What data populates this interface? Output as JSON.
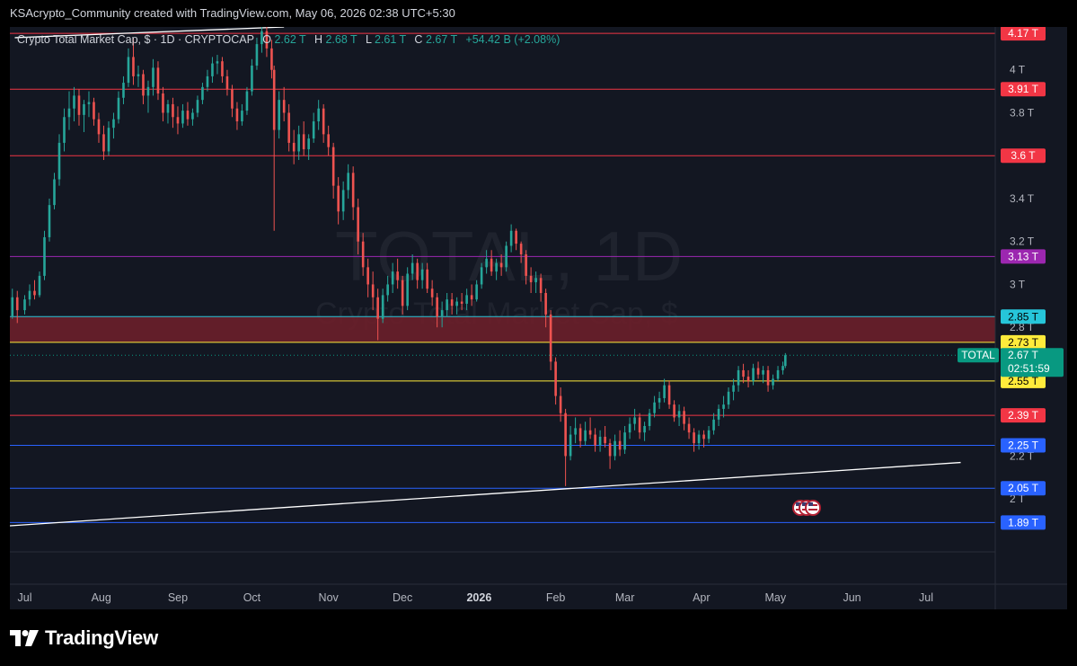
{
  "header": {
    "caption": "KSAcrypto_Community created with TradingView.com, May 06, 2026 02:38 UTC+5:30"
  },
  "legend": {
    "title": "Crypto Total Market Cap, $ · 1D · CRYPTOCAP",
    "o_label": "O",
    "o_value": "2.62 T",
    "h_label": "H",
    "h_value": "2.68 T",
    "l_label": "L",
    "l_value": "2.61 T",
    "c_label": "C",
    "c_value": "2.67 T",
    "change": "+54.42 B (+2.08%)"
  },
  "watermark": {
    "symbol": "TOTAL, 1D",
    "name": "Crypto Total Market Cap, $"
  },
  "footer": {
    "brand": "TradingView"
  },
  "colors": {
    "up": "#26a69a",
    "down": "#ef5350",
    "background": "#131722",
    "zone": "#6b1f2a"
  },
  "chart_data": {
    "type": "candlestick",
    "title": "Crypto Total Market Cap, $ · 1D · CRYPTOCAP",
    "price_unit": "T (trillion USD)",
    "x_range": [
      "2025-06-25",
      "2026-07-29"
    ],
    "y_range": [
      1.875,
      4.2
    ],
    "x_ticks": [
      {
        "label": "Jul",
        "date": "2025-07-01"
      },
      {
        "label": "Aug",
        "date": "2025-08-01"
      },
      {
        "label": "Sep",
        "date": "2025-09-01"
      },
      {
        "label": "Oct",
        "date": "2025-10-01"
      },
      {
        "label": "Nov",
        "date": "2025-11-01"
      },
      {
        "label": "Dec",
        "date": "2025-12-01"
      },
      {
        "label": "2026",
        "date": "2026-01-01",
        "bold": true
      },
      {
        "label": "Feb",
        "date": "2026-02-01"
      },
      {
        "label": "Mar",
        "date": "2026-03-01"
      },
      {
        "label": "Apr",
        "date": "2026-04-01"
      },
      {
        "label": "May",
        "date": "2026-05-01"
      },
      {
        "label": "Jun",
        "date": "2026-06-01"
      },
      {
        "label": "Jul",
        "date": "2026-07-01"
      }
    ],
    "y_ticks": [
      {
        "label": "4 T",
        "value": 4.0
      },
      {
        "label": "3.8 T",
        "value": 3.8
      },
      {
        "label": "3.4 T",
        "value": 3.4
      },
      {
        "label": "3.2 T",
        "value": 3.2
      },
      {
        "label": "3 T",
        "value": 3.0
      },
      {
        "label": "2.8 T",
        "value": 2.8
      },
      {
        "label": "2.2 T",
        "value": 2.2
      },
      {
        "label": "2 T",
        "value": 2.0
      }
    ],
    "horizontal_levels": [
      {
        "label": "4.17 T",
        "value": 4.17,
        "color": "#f23645",
        "text": "#ffffff"
      },
      {
        "label": "3.91 T",
        "value": 3.91,
        "color": "#f23645",
        "text": "#ffffff"
      },
      {
        "label": "3.6 T",
        "value": 3.6,
        "color": "#f23645",
        "text": "#ffffff"
      },
      {
        "label": "3.13 T",
        "value": 3.13,
        "color": "#9c27b0",
        "text": "#ffffff"
      },
      {
        "label": "2.85 T",
        "value": 2.85,
        "color": "#26c6da",
        "text": "#000000"
      },
      {
        "label": "2.73 T",
        "value": 2.73,
        "color": "#ffeb3b",
        "text": "#000000"
      },
      {
        "label": "2.55 T",
        "value": 2.55,
        "color": "#ffeb3b",
        "text": "#000000"
      },
      {
        "label": "2.39 T",
        "value": 2.39,
        "color": "#f23645",
        "text": "#ffffff"
      },
      {
        "label": "2.25 T",
        "value": 2.25,
        "color": "#2962ff",
        "text": "#ffffff"
      },
      {
        "label": "2.05 T",
        "value": 2.05,
        "color": "#2962ff",
        "text": "#ffffff"
      },
      {
        "label": "1.89 T",
        "value": 1.89,
        "color": "#2962ff",
        "text": "#ffffff"
      }
    ],
    "zone": {
      "from": 2.73,
      "to": 2.85
    },
    "last_price": {
      "name": "TOTAL",
      "value": 2.67,
      "label": "2.67 T",
      "countdown": "02:51:59",
      "color": "#089981"
    },
    "trendlines": [
      {
        "from": [
          "2025-06-25",
          1.875
        ],
        "to": [
          "2026-07-15",
          2.17
        ]
      },
      {
        "from": [
          "2025-06-27",
          4.15
        ],
        "to": [
          "2025-10-14",
          4.2
        ]
      }
    ],
    "candles": [
      [
        "2025-06-26",
        2.85,
        2.98,
        2.84,
        2.94
      ],
      [
        "2025-06-28",
        2.94,
        2.97,
        2.82,
        2.88
      ],
      [
        "2025-07-01",
        2.88,
        2.95,
        2.86,
        2.93
      ],
      [
        "2025-07-03",
        2.93,
        3.0,
        2.9,
        2.97
      ],
      [
        "2025-07-05",
        2.97,
        3.02,
        2.93,
        2.95
      ],
      [
        "2025-07-07",
        2.95,
        3.06,
        2.94,
        3.04
      ],
      [
        "2025-07-09",
        3.04,
        3.25,
        3.02,
        3.22
      ],
      [
        "2025-07-11",
        3.22,
        3.4,
        3.2,
        3.37
      ],
      [
        "2025-07-13",
        3.37,
        3.52,
        3.35,
        3.49
      ],
      [
        "2025-07-15",
        3.49,
        3.7,
        3.46,
        3.66
      ],
      [
        "2025-07-17",
        3.66,
        3.82,
        3.62,
        3.78
      ],
      [
        "2025-07-19",
        3.78,
        3.9,
        3.72,
        3.82
      ],
      [
        "2025-07-21",
        3.82,
        3.92,
        3.76,
        3.88
      ],
      [
        "2025-07-23",
        3.88,
        3.91,
        3.74,
        3.79
      ],
      [
        "2025-07-25",
        3.79,
        3.86,
        3.71,
        3.84
      ],
      [
        "2025-07-27",
        3.84,
        3.9,
        3.78,
        3.85
      ],
      [
        "2025-07-29",
        3.85,
        3.87,
        3.74,
        3.77
      ],
      [
        "2025-07-31",
        3.77,
        3.8,
        3.66,
        3.7
      ],
      [
        "2025-08-02",
        3.7,
        3.74,
        3.58,
        3.62
      ],
      [
        "2025-08-04",
        3.62,
        3.76,
        3.6,
        3.73
      ],
      [
        "2025-08-06",
        3.73,
        3.8,
        3.68,
        3.77
      ],
      [
        "2025-08-08",
        3.77,
        3.9,
        3.75,
        3.87
      ],
      [
        "2025-08-10",
        3.87,
        3.97,
        3.84,
        3.94
      ],
      [
        "2025-08-12",
        3.94,
        4.1,
        3.92,
        4.06
      ],
      [
        "2025-08-14",
        4.06,
        4.15,
        3.93,
        3.97
      ],
      [
        "2025-08-16",
        3.97,
        4.02,
        3.92,
        3.98
      ],
      [
        "2025-08-18",
        3.98,
        4.0,
        3.84,
        3.88
      ],
      [
        "2025-08-20",
        3.88,
        3.95,
        3.8,
        3.92
      ],
      [
        "2025-08-22",
        3.92,
        4.05,
        3.88,
        4.01
      ],
      [
        "2025-08-24",
        4.01,
        4.04,
        3.86,
        3.89
      ],
      [
        "2025-08-26",
        3.89,
        3.92,
        3.76,
        3.8
      ],
      [
        "2025-08-28",
        3.8,
        3.86,
        3.75,
        3.84
      ],
      [
        "2025-08-30",
        3.84,
        3.87,
        3.73,
        3.78
      ],
      [
        "2025-09-01",
        3.78,
        3.83,
        3.7,
        3.75
      ],
      [
        "2025-09-03",
        3.75,
        3.84,
        3.73,
        3.81
      ],
      [
        "2025-09-05",
        3.81,
        3.85,
        3.74,
        3.77
      ],
      [
        "2025-09-07",
        3.77,
        3.82,
        3.74,
        3.8
      ],
      [
        "2025-09-09",
        3.8,
        3.88,
        3.78,
        3.86
      ],
      [
        "2025-09-11",
        3.86,
        3.94,
        3.84,
        3.92
      ],
      [
        "2025-09-13",
        3.92,
        4.0,
        3.9,
        3.97
      ],
      [
        "2025-09-15",
        3.97,
        4.06,
        3.94,
        4.03
      ],
      [
        "2025-09-17",
        4.03,
        4.07,
        3.98,
        4.04
      ],
      [
        "2025-09-19",
        4.04,
        4.06,
        3.94,
        3.97
      ],
      [
        "2025-09-21",
        3.97,
        4.0,
        3.88,
        3.91
      ],
      [
        "2025-09-23",
        3.91,
        3.93,
        3.78,
        3.82
      ],
      [
        "2025-09-25",
        3.82,
        3.85,
        3.72,
        3.76
      ],
      [
        "2025-09-27",
        3.76,
        3.84,
        3.74,
        3.81
      ],
      [
        "2025-09-29",
        3.81,
        3.92,
        3.79,
        3.9
      ],
      [
        "2025-10-01",
        3.9,
        4.05,
        3.88,
        4.02
      ],
      [
        "2025-10-03",
        4.02,
        4.15,
        4.0,
        4.12
      ],
      [
        "2025-10-05",
        4.12,
        4.23,
        4.08,
        4.18
      ],
      [
        "2025-10-07",
        4.18,
        4.21,
        4.06,
        4.1
      ],
      [
        "2025-10-09",
        4.1,
        4.14,
        3.96,
        4.0
      ],
      [
        "2025-10-10",
        4.0,
        4.02,
        3.25,
        3.72
      ],
      [
        "2025-10-12",
        3.72,
        3.9,
        3.68,
        3.86
      ],
      [
        "2025-10-14",
        3.86,
        3.92,
        3.76,
        3.8
      ],
      [
        "2025-10-16",
        3.8,
        3.84,
        3.62,
        3.66
      ],
      [
        "2025-10-18",
        3.66,
        3.72,
        3.56,
        3.62
      ],
      [
        "2025-10-20",
        3.62,
        3.74,
        3.58,
        3.7
      ],
      [
        "2025-10-22",
        3.7,
        3.76,
        3.6,
        3.63
      ],
      [
        "2025-10-24",
        3.63,
        3.7,
        3.58,
        3.68
      ],
      [
        "2025-10-26",
        3.68,
        3.8,
        3.66,
        3.76
      ],
      [
        "2025-10-28",
        3.76,
        3.86,
        3.72,
        3.82
      ],
      [
        "2025-10-30",
        3.82,
        3.84,
        3.66,
        3.7
      ],
      [
        "2025-11-01",
        3.7,
        3.74,
        3.6,
        3.64
      ],
      [
        "2025-11-03",
        3.64,
        3.66,
        3.4,
        3.46
      ],
      [
        "2025-11-05",
        3.46,
        3.5,
        3.28,
        3.34
      ],
      [
        "2025-11-07",
        3.34,
        3.48,
        3.3,
        3.44
      ],
      [
        "2025-11-09",
        3.44,
        3.56,
        3.4,
        3.52
      ],
      [
        "2025-11-11",
        3.52,
        3.55,
        3.3,
        3.36
      ],
      [
        "2025-11-13",
        3.36,
        3.4,
        3.14,
        3.2
      ],
      [
        "2025-11-15",
        3.2,
        3.24,
        3.04,
        3.08
      ],
      [
        "2025-11-17",
        3.08,
        3.12,
        2.94,
        3.0
      ],
      [
        "2025-11-19",
        3.0,
        3.06,
        2.88,
        2.94
      ],
      [
        "2025-11-21",
        2.94,
        2.98,
        2.74,
        2.84
      ],
      [
        "2025-11-23",
        2.84,
        2.98,
        2.82,
        2.95
      ],
      [
        "2025-11-25",
        2.95,
        3.04,
        2.92,
        3.0
      ],
      [
        "2025-11-27",
        3.0,
        3.1,
        2.96,
        3.06
      ],
      [
        "2025-11-29",
        3.06,
        3.12,
        2.98,
        3.02
      ],
      [
        "2025-12-01",
        3.02,
        3.04,
        2.86,
        2.9
      ],
      [
        "2025-12-03",
        2.9,
        3.08,
        2.88,
        3.05
      ],
      [
        "2025-12-05",
        3.05,
        3.14,
        3.02,
        3.1
      ],
      [
        "2025-12-07",
        3.1,
        3.12,
        2.98,
        3.02
      ],
      [
        "2025-12-09",
        3.02,
        3.1,
        2.98,
        3.07
      ],
      [
        "2025-12-11",
        3.07,
        3.1,
        2.96,
        2.98
      ],
      [
        "2025-12-13",
        2.98,
        3.02,
        2.9,
        2.94
      ],
      [
        "2025-12-15",
        2.94,
        2.96,
        2.8,
        2.85
      ],
      [
        "2025-12-17",
        2.85,
        2.92,
        2.8,
        2.88
      ],
      [
        "2025-12-19",
        2.88,
        2.96,
        2.85,
        2.93
      ],
      [
        "2025-12-21",
        2.93,
        2.96,
        2.86,
        2.9
      ],
      [
        "2025-12-23",
        2.9,
        2.94,
        2.86,
        2.92
      ],
      [
        "2025-12-25",
        2.92,
        2.96,
        2.88,
        2.91
      ],
      [
        "2025-12-27",
        2.91,
        2.98,
        2.88,
        2.95
      ],
      [
        "2025-12-29",
        2.95,
        3.0,
        2.9,
        2.93
      ],
      [
        "2025-12-31",
        2.93,
        3.02,
        2.92,
        3.0
      ],
      [
        "2026-01-02",
        3.0,
        3.1,
        2.98,
        3.08
      ],
      [
        "2026-01-04",
        3.08,
        3.16,
        3.05,
        3.12
      ],
      [
        "2026-01-06",
        3.12,
        3.16,
        3.04,
        3.06
      ],
      [
        "2026-01-08",
        3.06,
        3.12,
        3.02,
        3.1
      ],
      [
        "2026-01-10",
        3.1,
        3.14,
        3.04,
        3.08
      ],
      [
        "2026-01-12",
        3.08,
        3.2,
        3.06,
        3.18
      ],
      [
        "2026-01-14",
        3.18,
        3.28,
        3.15,
        3.25
      ],
      [
        "2026-01-16",
        3.25,
        3.26,
        3.16,
        3.19
      ],
      [
        "2026-01-18",
        3.19,
        3.2,
        3.1,
        3.14
      ],
      [
        "2026-01-20",
        3.14,
        3.16,
        3.0,
        3.04
      ],
      [
        "2026-01-22",
        3.04,
        3.08,
        2.96,
        3.01
      ],
      [
        "2026-01-24",
        3.01,
        3.06,
        2.96,
        3.03
      ],
      [
        "2026-01-26",
        3.03,
        3.05,
        2.92,
        2.96
      ],
      [
        "2026-01-28",
        2.96,
        2.98,
        2.8,
        2.86
      ],
      [
        "2026-01-30",
        2.86,
        2.88,
        2.6,
        2.64
      ],
      [
        "2026-02-01",
        2.64,
        2.66,
        2.44,
        2.48
      ],
      [
        "2026-02-03",
        2.48,
        2.52,
        2.36,
        2.4
      ],
      [
        "2026-02-05",
        2.4,
        2.42,
        2.06,
        2.2
      ],
      [
        "2026-02-07",
        2.2,
        2.34,
        2.18,
        2.3
      ],
      [
        "2026-02-09",
        2.3,
        2.38,
        2.26,
        2.33
      ],
      [
        "2026-02-11",
        2.33,
        2.35,
        2.24,
        2.27
      ],
      [
        "2026-02-13",
        2.27,
        2.36,
        2.25,
        2.32
      ],
      [
        "2026-02-15",
        2.32,
        2.38,
        2.28,
        2.3
      ],
      [
        "2026-02-17",
        2.3,
        2.33,
        2.22,
        2.25
      ],
      [
        "2026-02-19",
        2.25,
        2.32,
        2.22,
        2.29
      ],
      [
        "2026-02-21",
        2.29,
        2.34,
        2.24,
        2.26
      ],
      [
        "2026-02-23",
        2.26,
        2.28,
        2.14,
        2.2
      ],
      [
        "2026-02-25",
        2.2,
        2.3,
        2.18,
        2.27
      ],
      [
        "2026-02-27",
        2.27,
        2.32,
        2.2,
        2.23
      ],
      [
        "2026-03-01",
        2.23,
        2.34,
        2.21,
        2.31
      ],
      [
        "2026-03-03",
        2.31,
        2.38,
        2.28,
        2.35
      ],
      [
        "2026-03-05",
        2.35,
        2.42,
        2.32,
        2.38
      ],
      [
        "2026-03-07",
        2.38,
        2.4,
        2.28,
        2.31
      ],
      [
        "2026-03-09",
        2.31,
        2.36,
        2.27,
        2.34
      ],
      [
        "2026-03-11",
        2.34,
        2.42,
        2.32,
        2.4
      ],
      [
        "2026-03-13",
        2.4,
        2.48,
        2.38,
        2.45
      ],
      [
        "2026-03-15",
        2.45,
        2.5,
        2.42,
        2.47
      ],
      [
        "2026-03-17",
        2.47,
        2.56,
        2.45,
        2.53
      ],
      [
        "2026-03-19",
        2.53,
        2.55,
        2.42,
        2.44
      ],
      [
        "2026-03-21",
        2.44,
        2.46,
        2.36,
        2.38
      ],
      [
        "2026-03-23",
        2.38,
        2.44,
        2.34,
        2.41
      ],
      [
        "2026-03-25",
        2.41,
        2.43,
        2.32,
        2.35
      ],
      [
        "2026-03-27",
        2.35,
        2.38,
        2.28,
        2.31
      ],
      [
        "2026-03-29",
        2.31,
        2.33,
        2.22,
        2.26
      ],
      [
        "2026-03-31",
        2.26,
        2.32,
        2.23,
        2.3
      ],
      [
        "2026-04-02",
        2.3,
        2.32,
        2.24,
        2.28
      ],
      [
        "2026-04-04",
        2.28,
        2.34,
        2.26,
        2.32
      ],
      [
        "2026-04-06",
        2.32,
        2.4,
        2.3,
        2.37
      ],
      [
        "2026-04-08",
        2.37,
        2.44,
        2.34,
        2.42
      ],
      [
        "2026-04-10",
        2.42,
        2.48,
        2.38,
        2.44
      ],
      [
        "2026-04-12",
        2.44,
        2.52,
        2.42,
        2.5
      ],
      [
        "2026-04-14",
        2.5,
        2.56,
        2.46,
        2.53
      ],
      [
        "2026-04-16",
        2.53,
        2.62,
        2.5,
        2.6
      ],
      [
        "2026-04-18",
        2.6,
        2.63,
        2.54,
        2.57
      ],
      [
        "2026-04-20",
        2.57,
        2.6,
        2.52,
        2.55
      ],
      [
        "2026-04-22",
        2.55,
        2.63,
        2.53,
        2.61
      ],
      [
        "2026-04-24",
        2.61,
        2.64,
        2.56,
        2.58
      ],
      [
        "2026-04-26",
        2.58,
        2.62,
        2.54,
        2.6
      ],
      [
        "2026-04-28",
        2.6,
        2.62,
        2.5,
        2.53
      ],
      [
        "2026-04-30",
        2.53,
        2.58,
        2.51,
        2.56
      ],
      [
        "2026-05-02",
        2.56,
        2.62,
        2.55,
        2.6
      ],
      [
        "2026-05-04",
        2.6,
        2.64,
        2.58,
        2.62
      ],
      [
        "2026-05-05",
        2.62,
        2.68,
        2.61,
        2.67
      ]
    ]
  }
}
